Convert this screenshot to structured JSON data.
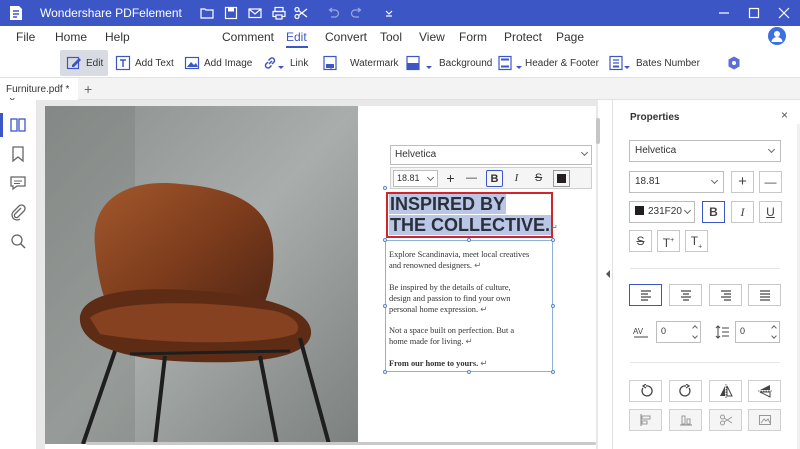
{
  "titlebar": {
    "title": "Wondershare PDFelement",
    "accent": "#3d56c6"
  },
  "menu": {
    "file": "File",
    "home": "Home",
    "help": "Help",
    "comment": "Comment",
    "edit": "Edit",
    "convert": "Convert",
    "tool": "Tool",
    "view": "View",
    "form": "Form",
    "protect": "Protect",
    "page": "Page"
  },
  "ribbon": {
    "edit": "Edit",
    "add_text": "Add Text",
    "add_image": "Add Image",
    "link": "Link",
    "watermark": "Watermark",
    "background": "Background",
    "header_footer": "Header & Footer",
    "bates_number": "Bates Number"
  },
  "tabs": {
    "active": "Furniture.pdf *",
    "close": "×",
    "new": "+"
  },
  "float_toolbar": {
    "font": "Helvetica",
    "size": "18.81",
    "plus": "+",
    "minus": "—",
    "bold": "B",
    "italic": "I",
    "strike": "S"
  },
  "document": {
    "headline_line1": "INSPIRED BY",
    "headline_line2": "THE COLLECTIVE.",
    "para1_line1": "Explore Scandinavia, meet local creatives",
    "para1_line2": "and renowned designers.",
    "para2_line1": "Be inspired by the details of culture,",
    "para2_line2": "design and passion to find your own",
    "para2_line3": "personal home expression.",
    "para3_line1": "Not a space built on perfection. But a",
    "para3_line2": "home made for living.",
    "para4": "From our home to yours.",
    "return_mark": "↵"
  },
  "properties": {
    "title": "Properties",
    "close": "×",
    "font": "Helvetica",
    "size": "18.81",
    "size_plus": "+",
    "size_minus": "—",
    "color_hex": "231F20",
    "bold": "B",
    "italic": "I",
    "underline": "U",
    "strike": "S",
    "superscript": "T",
    "subscript": "T",
    "char_spacing": "0",
    "line_spacing": "0"
  }
}
